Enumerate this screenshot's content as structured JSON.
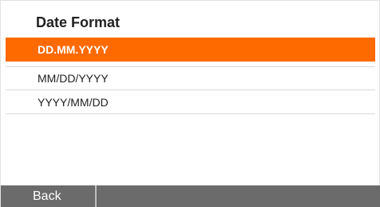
{
  "header": {
    "title": "Date Format"
  },
  "options": [
    {
      "label": "DD.MM.YYYY",
      "selected": true
    },
    {
      "label": "MM/DD/YYYY",
      "selected": false
    },
    {
      "label": "YYYY/MM/DD",
      "selected": false
    }
  ],
  "footer": {
    "back_label": "Back"
  },
  "colors": {
    "accent": "#ff6a00",
    "footer": "#6b6b6b"
  }
}
